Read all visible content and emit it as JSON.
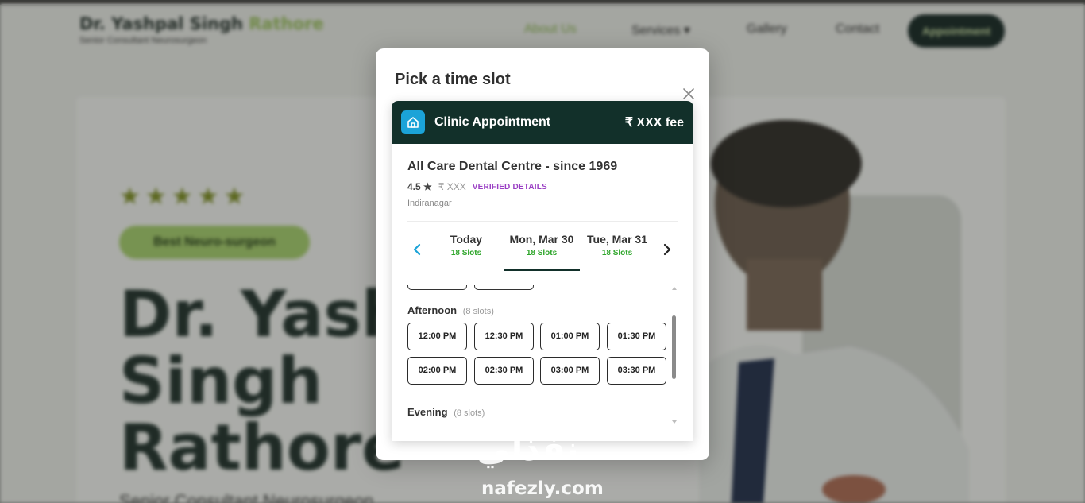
{
  "background_page": {
    "brand_name": "Dr. Yashpal Singh",
    "brand_accent": "Rathore",
    "brand_subtitle": "Senior Consultant Neurosurgeon",
    "nav": [
      "About Us",
      "Services",
      "Gallery",
      "Contact"
    ],
    "nav_services_chevron": "▾",
    "appointment_button": "Appointment",
    "stars": "★★★★★",
    "pill": "Best Neuro-surgeon",
    "hero_name_lines": [
      "Dr. Yashp",
      "Singh",
      "Rathore"
    ],
    "hero_subtitle": "Senior Consultant Neurosurgeon"
  },
  "modal": {
    "title": "Pick a time slot",
    "close_icon": "close-icon",
    "card": {
      "header_title": "Clinic Appointment",
      "header_fee": "₹ XXX fee",
      "home_icon": "home-icon",
      "clinic_name": "All Care Dental Centre - since 1969",
      "rating": "4.5 ★",
      "price": "₹ XXX",
      "verified": "VERIFIED DETAILS",
      "locality": "Indiranagar"
    },
    "dates": [
      {
        "label": "Today",
        "slots": "18 Slots",
        "selected": false
      },
      {
        "label": "Mon, Mar 30",
        "slots": "18 Slots",
        "selected": true
      },
      {
        "label": "Tue, Mar 31",
        "slots": "18 Slots",
        "selected": false
      }
    ],
    "sections": [
      {
        "title": "Afternoon",
        "count": "(8 slots)",
        "slots": [
          "12:00 PM",
          "12:30 PM",
          "01:00 PM",
          "01:30 PM",
          "02:00 PM",
          "02:30 PM",
          "03:00 PM",
          "03:30 PM"
        ]
      },
      {
        "title": "Evening",
        "count": "(8 slots)",
        "slots": []
      }
    ]
  },
  "watermark": {
    "arabic": "نفذلي",
    "latin": "nafezly.com"
  },
  "colors": {
    "header_bg": "#12302a",
    "home_badge": "#1ba3d8",
    "slot_count_green": "#2ea52a",
    "verified_purple": "#9a3fc4",
    "brand_accent_green": "#9bc35b"
  }
}
